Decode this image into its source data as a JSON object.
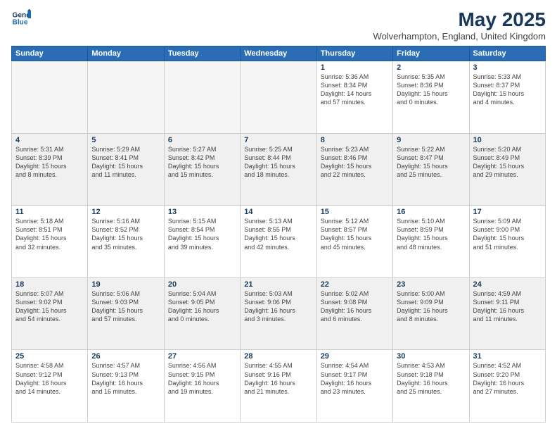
{
  "logo": {
    "line1": "General",
    "line2": "Blue"
  },
  "title": "May 2025",
  "subtitle": "Wolverhampton, England, United Kingdom",
  "headers": [
    "Sunday",
    "Monday",
    "Tuesday",
    "Wednesday",
    "Thursday",
    "Friday",
    "Saturday"
  ],
  "weeks": [
    [
      {
        "day": "",
        "info": "",
        "empty": true
      },
      {
        "day": "",
        "info": "",
        "empty": true
      },
      {
        "day": "",
        "info": "",
        "empty": true
      },
      {
        "day": "",
        "info": "",
        "empty": true
      },
      {
        "day": "1",
        "info": "Sunrise: 5:36 AM\nSunset: 8:34 PM\nDaylight: 14 hours\nand 57 minutes."
      },
      {
        "day": "2",
        "info": "Sunrise: 5:35 AM\nSunset: 8:36 PM\nDaylight: 15 hours\nand 0 minutes."
      },
      {
        "day": "3",
        "info": "Sunrise: 5:33 AM\nSunset: 8:37 PM\nDaylight: 15 hours\nand 4 minutes."
      }
    ],
    [
      {
        "day": "4",
        "info": "Sunrise: 5:31 AM\nSunset: 8:39 PM\nDaylight: 15 hours\nand 8 minutes."
      },
      {
        "day": "5",
        "info": "Sunrise: 5:29 AM\nSunset: 8:41 PM\nDaylight: 15 hours\nand 11 minutes."
      },
      {
        "day": "6",
        "info": "Sunrise: 5:27 AM\nSunset: 8:42 PM\nDaylight: 15 hours\nand 15 minutes."
      },
      {
        "day": "7",
        "info": "Sunrise: 5:25 AM\nSunset: 8:44 PM\nDaylight: 15 hours\nand 18 minutes."
      },
      {
        "day": "8",
        "info": "Sunrise: 5:23 AM\nSunset: 8:46 PM\nDaylight: 15 hours\nand 22 minutes."
      },
      {
        "day": "9",
        "info": "Sunrise: 5:22 AM\nSunset: 8:47 PM\nDaylight: 15 hours\nand 25 minutes."
      },
      {
        "day": "10",
        "info": "Sunrise: 5:20 AM\nSunset: 8:49 PM\nDaylight: 15 hours\nand 29 minutes."
      }
    ],
    [
      {
        "day": "11",
        "info": "Sunrise: 5:18 AM\nSunset: 8:51 PM\nDaylight: 15 hours\nand 32 minutes."
      },
      {
        "day": "12",
        "info": "Sunrise: 5:16 AM\nSunset: 8:52 PM\nDaylight: 15 hours\nand 35 minutes."
      },
      {
        "day": "13",
        "info": "Sunrise: 5:15 AM\nSunset: 8:54 PM\nDaylight: 15 hours\nand 39 minutes."
      },
      {
        "day": "14",
        "info": "Sunrise: 5:13 AM\nSunset: 8:55 PM\nDaylight: 15 hours\nand 42 minutes."
      },
      {
        "day": "15",
        "info": "Sunrise: 5:12 AM\nSunset: 8:57 PM\nDaylight: 15 hours\nand 45 minutes."
      },
      {
        "day": "16",
        "info": "Sunrise: 5:10 AM\nSunset: 8:59 PM\nDaylight: 15 hours\nand 48 minutes."
      },
      {
        "day": "17",
        "info": "Sunrise: 5:09 AM\nSunset: 9:00 PM\nDaylight: 15 hours\nand 51 minutes."
      }
    ],
    [
      {
        "day": "18",
        "info": "Sunrise: 5:07 AM\nSunset: 9:02 PM\nDaylight: 15 hours\nand 54 minutes."
      },
      {
        "day": "19",
        "info": "Sunrise: 5:06 AM\nSunset: 9:03 PM\nDaylight: 15 hours\nand 57 minutes."
      },
      {
        "day": "20",
        "info": "Sunrise: 5:04 AM\nSunset: 9:05 PM\nDaylight: 16 hours\nand 0 minutes."
      },
      {
        "day": "21",
        "info": "Sunrise: 5:03 AM\nSunset: 9:06 PM\nDaylight: 16 hours\nand 3 minutes."
      },
      {
        "day": "22",
        "info": "Sunrise: 5:02 AM\nSunset: 9:08 PM\nDaylight: 16 hours\nand 6 minutes."
      },
      {
        "day": "23",
        "info": "Sunrise: 5:00 AM\nSunset: 9:09 PM\nDaylight: 16 hours\nand 8 minutes."
      },
      {
        "day": "24",
        "info": "Sunrise: 4:59 AM\nSunset: 9:11 PM\nDaylight: 16 hours\nand 11 minutes."
      }
    ],
    [
      {
        "day": "25",
        "info": "Sunrise: 4:58 AM\nSunset: 9:12 PM\nDaylight: 16 hours\nand 14 minutes."
      },
      {
        "day": "26",
        "info": "Sunrise: 4:57 AM\nSunset: 9:13 PM\nDaylight: 16 hours\nand 16 minutes."
      },
      {
        "day": "27",
        "info": "Sunrise: 4:56 AM\nSunset: 9:15 PM\nDaylight: 16 hours\nand 19 minutes."
      },
      {
        "day": "28",
        "info": "Sunrise: 4:55 AM\nSunset: 9:16 PM\nDaylight: 16 hours\nand 21 minutes."
      },
      {
        "day": "29",
        "info": "Sunrise: 4:54 AM\nSunset: 9:17 PM\nDaylight: 16 hours\nand 23 minutes."
      },
      {
        "day": "30",
        "info": "Sunrise: 4:53 AM\nSunset: 9:18 PM\nDaylight: 16 hours\nand 25 minutes."
      },
      {
        "day": "31",
        "info": "Sunrise: 4:52 AM\nSunset: 9:20 PM\nDaylight: 16 hours\nand 27 minutes."
      }
    ]
  ]
}
